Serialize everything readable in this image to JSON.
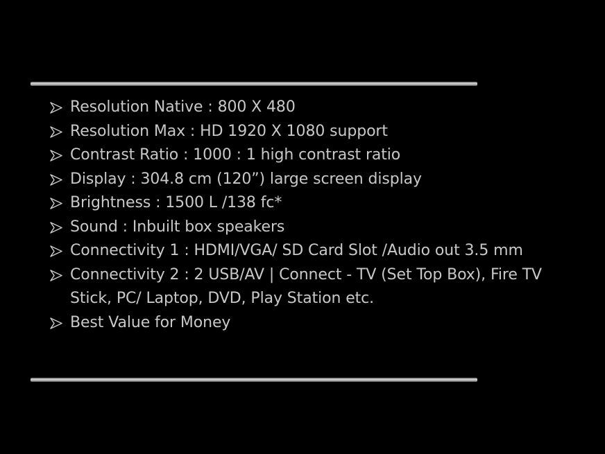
{
  "slide": {
    "bullet_icon": "arrowhead-bullet-icon",
    "text_color": "#c8c8c8",
    "background": "#000000",
    "items": [
      "Resolution Native : 800 X 480",
      "Resolution Max : HD 1920 X 1080 support",
      "Contrast Ratio : 1000 : 1 high contrast ratio",
      "Display : 304.8 cm (120”) large screen display",
      "Brightness : 1500 L /138 fc*",
      "Sound : Inbuilt box speakers",
      "Connectivity 1 : HDMI/VGA/ SD Card Slot /Audio out 3.5 mm",
      "Connectivity 2 : 2 USB/AV | Connect - TV (Set Top Box), Fire TV Stick, PC/ Laptop, DVD, Play Station etc.",
      "Best Value for Money"
    ]
  }
}
